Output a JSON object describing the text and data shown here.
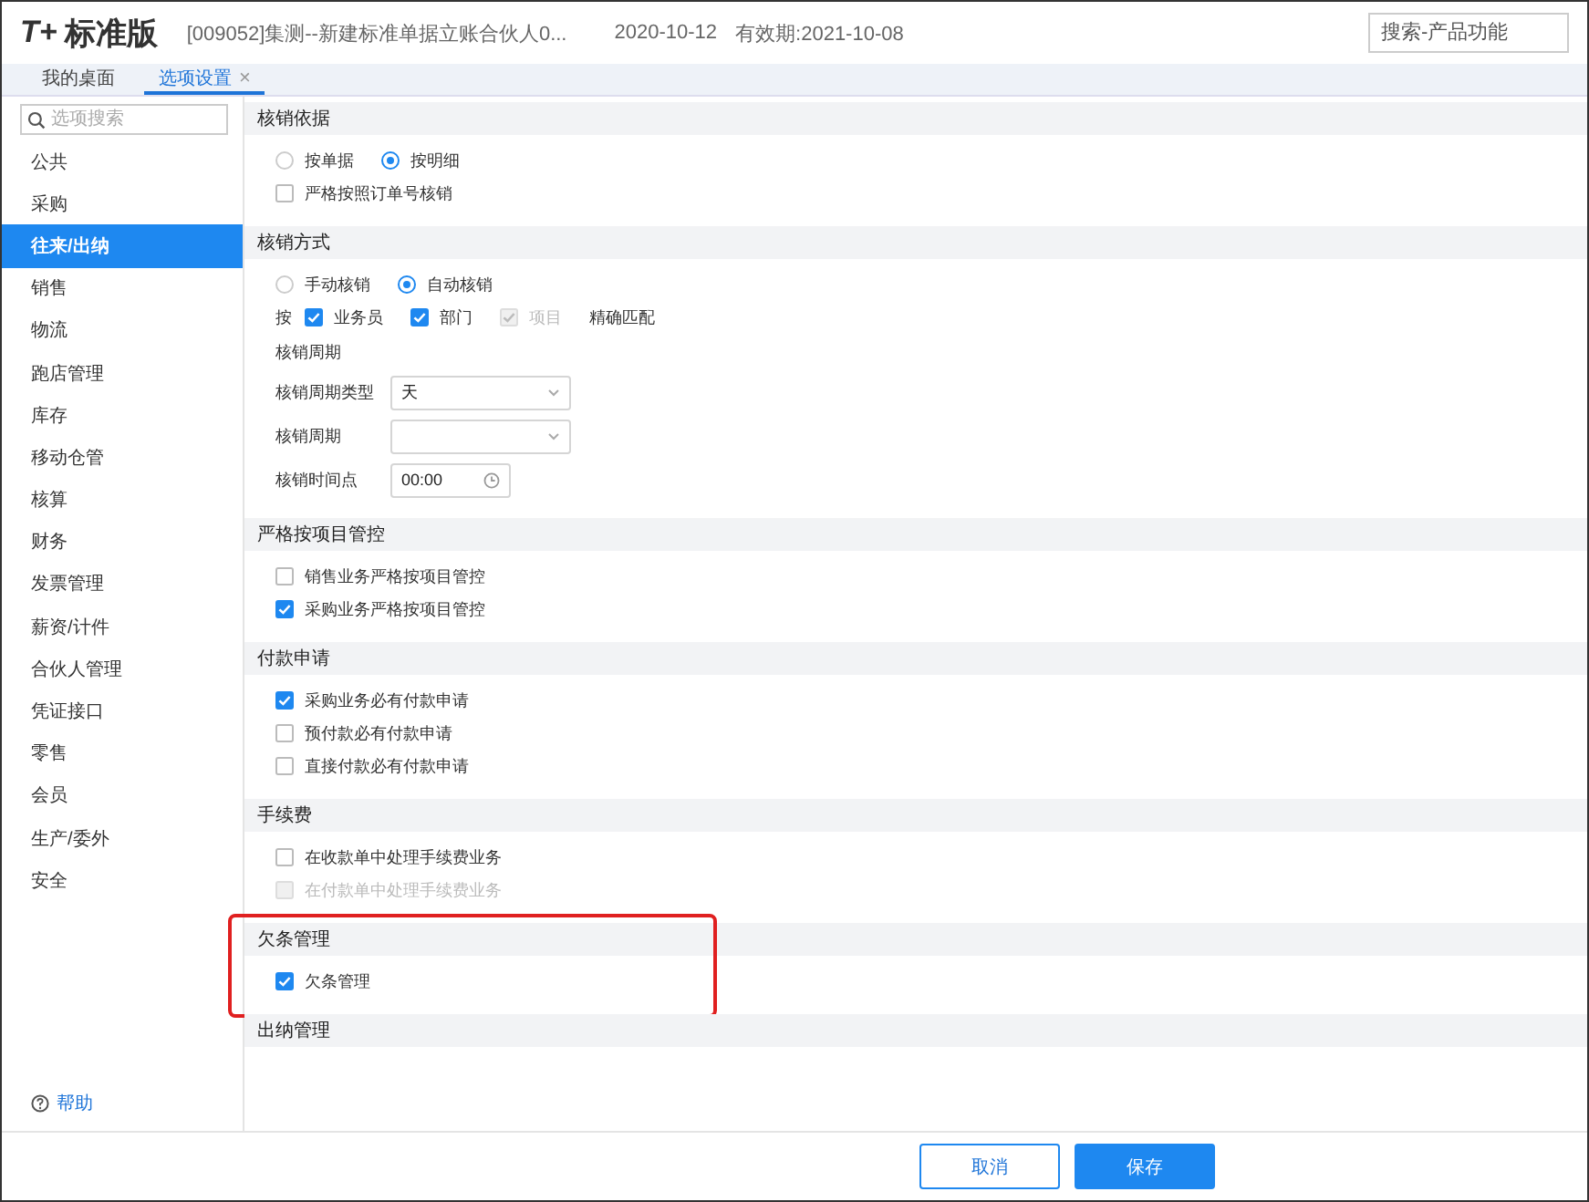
{
  "header": {
    "logo_mark": "T+",
    "logo_text": "标准版",
    "account": "[009052]集测--新建标准单据立账合伙人0...",
    "date": "2020-10-12",
    "expiry": "有效期:2021-10-08",
    "search": {
      "placeholder": "搜索-产品功能"
    }
  },
  "tabs": [
    {
      "label": "我的桌面",
      "selected": false,
      "closable": false
    },
    {
      "label": "选项设置",
      "selected": true,
      "closable": true,
      "close": "×"
    }
  ],
  "sidebar": {
    "search": {
      "placeholder": "选项搜索"
    },
    "items": [
      {
        "label": "公共",
        "selected": false
      },
      {
        "label": "采购",
        "selected": false
      },
      {
        "label": "往来/出纳",
        "selected": true
      },
      {
        "label": "销售",
        "selected": false
      },
      {
        "label": "物流",
        "selected": false
      },
      {
        "label": "跑店管理",
        "selected": false
      },
      {
        "label": "库存",
        "selected": false
      },
      {
        "label": "移动仓管",
        "selected": false
      },
      {
        "label": "核算",
        "selected": false
      },
      {
        "label": "财务",
        "selected": false
      },
      {
        "label": "发票管理",
        "selected": false
      },
      {
        "label": "薪资/计件",
        "selected": false
      },
      {
        "label": "合伙人管理",
        "selected": false
      },
      {
        "label": "凭证接口",
        "selected": false
      },
      {
        "label": "零售",
        "selected": false
      },
      {
        "label": "会员",
        "selected": false
      },
      {
        "label": "生产/委外",
        "selected": false
      },
      {
        "label": "安全",
        "selected": false
      }
    ],
    "help": "帮助"
  },
  "sections": [
    {
      "title": "核销依据",
      "highlighted": false,
      "items": [
        {
          "kind": "radios",
          "options": [
            {
              "label": "按单据",
              "selected": false
            },
            {
              "label": "按明细",
              "selected": true
            }
          ]
        },
        {
          "kind": "checkbox",
          "label": "严格按照订单号核销",
          "checked": false,
          "disabled": false
        }
      ]
    },
    {
      "title": "核销方式",
      "highlighted": false,
      "items": [
        {
          "kind": "radios",
          "options": [
            {
              "label": "手动核销",
              "selected": false
            },
            {
              "label": "自动核销",
              "selected": true
            }
          ]
        },
        {
          "kind": "checkrow",
          "prefix": "按",
          "checks": [
            {
              "label": "业务员",
              "checked": true,
              "disabled": false
            },
            {
              "label": "部门",
              "checked": true,
              "disabled": false
            },
            {
              "label": "项目",
              "checked": true,
              "disabled": true
            }
          ],
          "suffix": "精确匹配"
        },
        {
          "kind": "label",
          "label": "核销周期"
        },
        {
          "kind": "select",
          "label": "核销周期类型",
          "value": "天"
        },
        {
          "kind": "select",
          "label": "核销周期"
        },
        {
          "kind": "time",
          "label": "核销时间点",
          "value": "00:00"
        }
      ]
    },
    {
      "title": "严格按项目管控",
      "highlighted": false,
      "items": [
        {
          "kind": "checkbox",
          "label": "销售业务严格按项目管控",
          "checked": false,
          "disabled": false
        },
        {
          "kind": "checkbox",
          "label": "采购业务严格按项目管控",
          "checked": true,
          "disabled": false
        }
      ]
    },
    {
      "title": "付款申请",
      "highlighted": false,
      "items": [
        {
          "kind": "checkbox",
          "label": "采购业务必有付款申请",
          "checked": true,
          "disabled": false
        },
        {
          "kind": "checkbox",
          "label": "预付款必有付款申请",
          "checked": false,
          "disabled": false
        },
        {
          "kind": "checkbox",
          "label": "直接付款必有付款申请",
          "checked": false,
          "disabled": false
        }
      ]
    },
    {
      "title": "手续费",
      "highlighted": false,
      "items": [
        {
          "kind": "checkbox",
          "label": "在收款单中处理手续费业务",
          "checked": false,
          "disabled": false
        },
        {
          "kind": "checkbox",
          "label": "在付款单中处理手续费业务",
          "checked": false,
          "disabled": true
        }
      ]
    },
    {
      "title": "欠条管理",
      "highlighted": true,
      "items": [
        {
          "kind": "checkbox",
          "label": "欠条管理",
          "checked": true,
          "disabled": false
        }
      ]
    },
    {
      "title": "出纳管理",
      "highlighted": false
    }
  ],
  "footer": {
    "buttons": [
      {
        "label": "取消",
        "kind": "secondary"
      },
      {
        "label": "保存",
        "kind": "primary"
      }
    ]
  }
}
